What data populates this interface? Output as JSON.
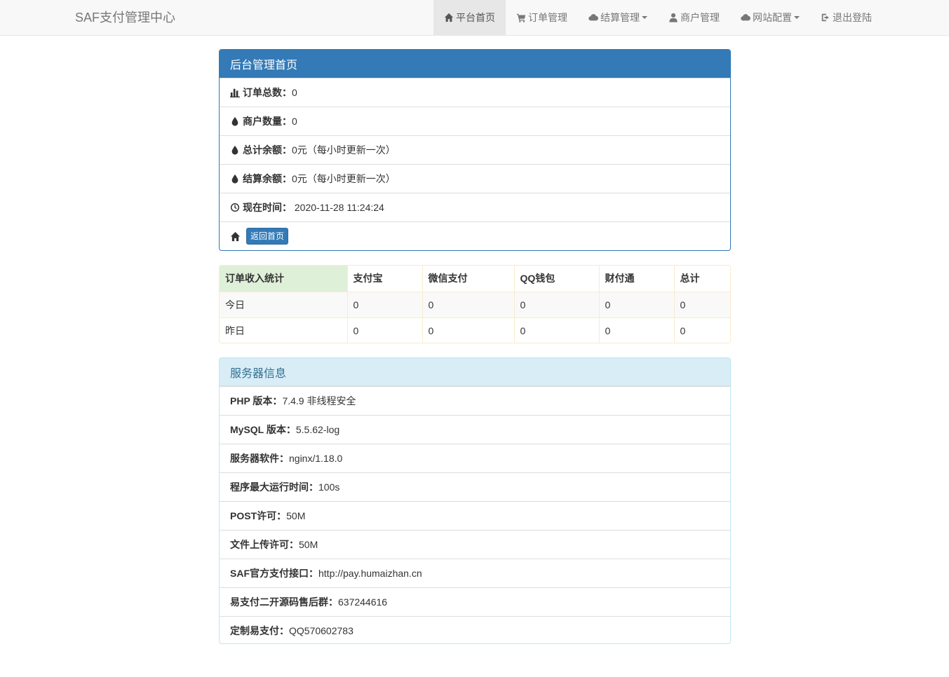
{
  "brand": "SAF支付管理中心",
  "nav": [
    {
      "label": "平台首页",
      "icon": "home-icon",
      "active": true
    },
    {
      "label": "订单管理",
      "icon": "cart-icon"
    },
    {
      "label": "结算管理",
      "icon": "cloud-icon",
      "dropdown": true
    },
    {
      "label": "商户管理",
      "icon": "user-icon"
    },
    {
      "label": "网站配置",
      "icon": "cloud-icon",
      "dropdown": true
    },
    {
      "label": "退出登陆",
      "icon": "logout-icon"
    }
  ],
  "admin_panel": {
    "title": "后台管理首页",
    "items": [
      {
        "icon": "bar-chart-icon",
        "label": "订单总数：",
        "value": "0"
      },
      {
        "icon": "drop-icon",
        "label": "商户数量：",
        "value": "0"
      },
      {
        "icon": "drop-icon",
        "label": "总计余额：",
        "value": "0元（每小时更新一次）"
      },
      {
        "icon": "drop-icon",
        "label": "结算余额：",
        "value": "0元（每小时更新一次）"
      },
      {
        "icon": "clock-icon",
        "label": "现在时间：",
        "value": " 2020-11-28 11:24:24"
      }
    ],
    "home_button": "返回首页"
  },
  "income_table": {
    "headers": [
      "订单收入统计",
      "支付宝",
      "微信支付",
      "QQ钱包",
      "财付通",
      "总计"
    ],
    "rows": [
      [
        "今日",
        "0",
        "0",
        "0",
        "0",
        "0"
      ],
      [
        "昨日",
        "0",
        "0",
        "0",
        "0",
        "0"
      ]
    ]
  },
  "server_panel": {
    "title": "服务器信息",
    "items": [
      {
        "label": "PHP 版本：",
        "value": "7.4.9 非线程安全"
      },
      {
        "label": "MySQL 版本：",
        "value": "5.5.62-log"
      },
      {
        "label": "服务器软件：",
        "value": "nginx/1.18.0"
      },
      {
        "label": "程序最大运行时间：",
        "value": "100s"
      },
      {
        "label": "POST许可：",
        "value": "50M"
      },
      {
        "label": "文件上传许可：",
        "value": "50M"
      },
      {
        "label": "SAF官方支付接口：",
        "value": "http://pay.humaizhan.cn"
      },
      {
        "label": "易支付二开源码售后群：",
        "value": "637244616"
      },
      {
        "label": "定制易支付：",
        "value": "QQ570602783"
      }
    ]
  }
}
